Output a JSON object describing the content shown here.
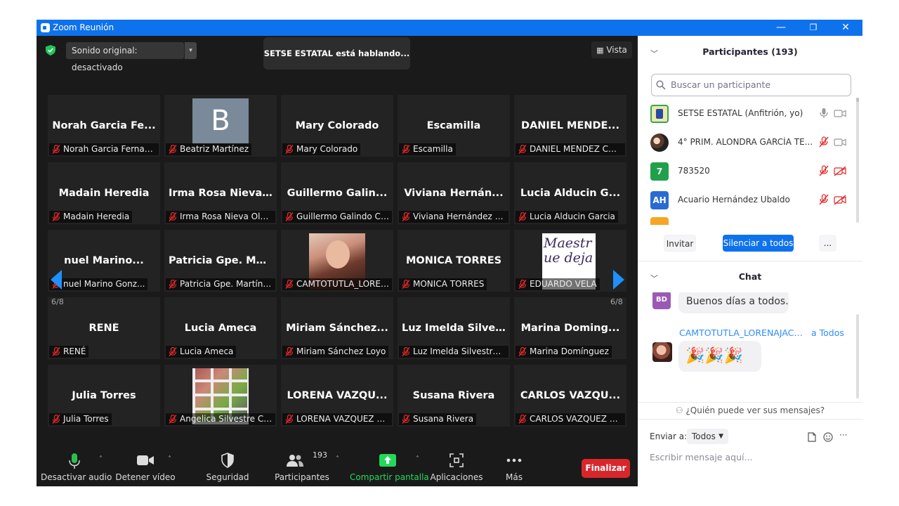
{
  "window": {
    "title": "Zoom Reunión",
    "minimize": "—",
    "restore": "❐",
    "close": "✕"
  },
  "meeting": {
    "sound_button": "Sonido original: desactivado",
    "sound_caret": "▾",
    "speaking_banner": "SETSE ESTATAL está hablando...",
    "view_button": "Vista",
    "page_left": "6/8",
    "page_right": "6/8"
  },
  "tiles": [
    {
      "big": "Norah Garcia Fe...",
      "label": "Norah Garcia Fernan..."
    },
    {
      "big": "",
      "avatar_letter": "B",
      "label": "Beatriz Martínez"
    },
    {
      "big": "Mary Colorado",
      "label": "Mary Colorado"
    },
    {
      "big": "Escamilla",
      "label": "Escamilla"
    },
    {
      "big": "DANIEL MENDE...",
      "label": "DANIEL MENDEZ CAS..."
    },
    {
      "big": "Madain Heredia",
      "label": "Madain Heredia"
    },
    {
      "big": "Irma Rosa Nieva...",
      "label": "Irma Rosa Nieva Olm..."
    },
    {
      "big": "Guillermo Galin...",
      "label": "Guillermo Galindo Co..."
    },
    {
      "big": "Viviana Hernán...",
      "label": "Viviana Hernández d..."
    },
    {
      "big": "Lucia Alducin G...",
      "label": "Lucia Alducin Garcia"
    },
    {
      "big": "nuel Marino...",
      "label": "nuel Marino Gonz..."
    },
    {
      "big": "Patricia Gpe. Ma...",
      "label": "Patricia Gpe. Martíne..."
    },
    {
      "big": "",
      "label": "CAMTOTUTLA_LOREN..."
    },
    {
      "big": "MONICA TORRES",
      "label": "MONICA TORRES"
    },
    {
      "big": "",
      "photo_text": "Maestr ue deja",
      "label": "EDUARDO VELA"
    },
    {
      "big": "RENÉ",
      "label": "RENÉ"
    },
    {
      "big": "Lucia Ameca",
      "label": "Lucia Ameca"
    },
    {
      "big": "Miriam Sánchez...",
      "label": "Miriam Sánchez Loyo"
    },
    {
      "big": "Luz Imelda Silve...",
      "label": "Luz Imelda Silvestre C..."
    },
    {
      "big": "Marina Doming...",
      "label": "Marina Domínguez"
    },
    {
      "big": "Julia Torres",
      "label": "Julia Torres"
    },
    {
      "big": "",
      "label": "Angelica Silvestre Ch..."
    },
    {
      "big": "LORENA VAZQU...",
      "label": "LORENA VAZQUEZ A..."
    },
    {
      "big": "Susana Rivera",
      "label": "Susana Rivera"
    },
    {
      "big": "CARLOS VAZQU...",
      "label": "CARLOS VAZQUEZ SA..."
    }
  ],
  "toolbar": {
    "audio": "Desactivar audio",
    "video": "Detener vídeo",
    "security": "Seguridad",
    "participants": "Participantes",
    "participants_count": "193",
    "share": "Compartir pantalla",
    "apps": "Aplicaciones",
    "more": "Más",
    "end": "Finalizar",
    "caret": "˄"
  },
  "participants": {
    "header": "Participantes (193)",
    "search_placeholder": "Buscar un participante",
    "list": [
      {
        "name": "SETSE ESTATAL (Anfitrión, yo)",
        "avatar": "",
        "color": "#e9e9b0"
      },
      {
        "name": "4° PRIM. ALONDRA GARCÍA TE...",
        "avatar": "",
        "color": "#6b4b3a"
      },
      {
        "name": "783520",
        "avatar": "7",
        "color": "#20a04a"
      },
      {
        "name": "Acuario Hernández Ubaldo",
        "avatar": "AH",
        "color": "#2a6bd3"
      }
    ],
    "invite": "Invitar",
    "mute_all": "Silenciar a todos",
    "more": "..."
  },
  "chat": {
    "header": "Chat",
    "msg1_avatar": "BD",
    "msg1_text": "Buenos días a todos.",
    "msg2_sender": "CAMTOTUTLA_LORENAJACO...",
    "msg2_to": "a Todos",
    "msg2_text": "🎉🎉🎉",
    "who_sees": "¿Quién puede ver sus mensajes?",
    "send_to_label": "Enviar a:",
    "send_to_value": "Todos",
    "input_placeholder": "Escribir mensaje aquí...",
    "more": "···"
  },
  "colors": {
    "accent": "#0e72ed",
    "share_green": "#23d959",
    "end_red": "#d9262b",
    "muted_red": "#e02828"
  }
}
